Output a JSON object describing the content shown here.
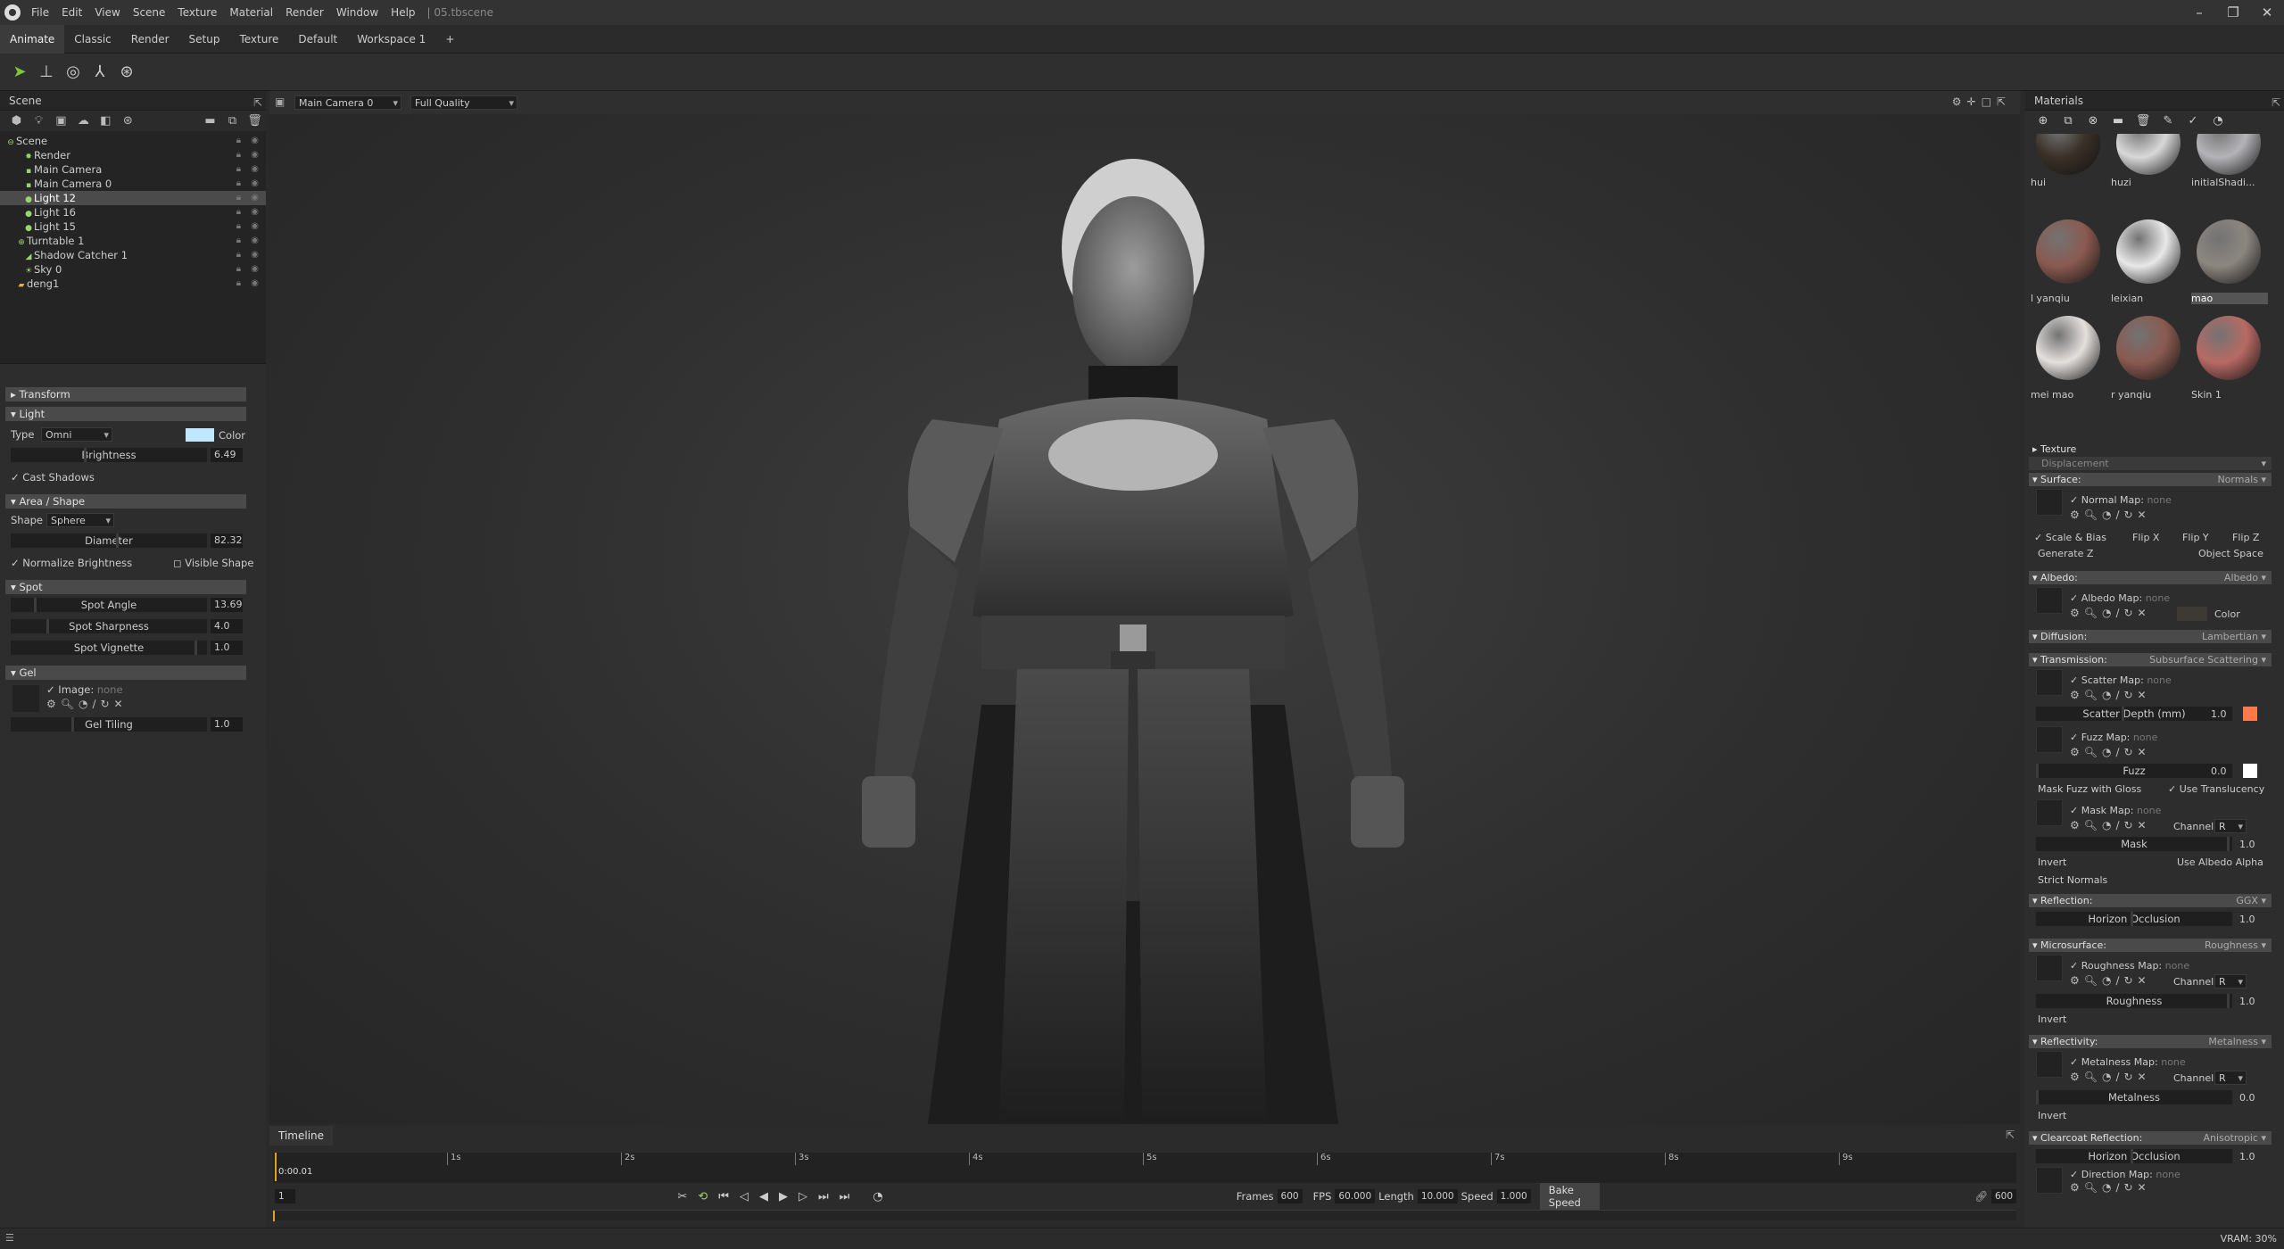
{
  "app": {
    "file_title": "05.tbscene"
  },
  "menu": [
    "File",
    "Edit",
    "View",
    "Scene",
    "Texture",
    "Material",
    "Render",
    "Window",
    "Help"
  ],
  "workspace_tabs": [
    "Animate",
    "Classic",
    "Render",
    "Setup",
    "Texture",
    "Default",
    "Workspace 1",
    "+"
  ],
  "toolbar_icons": [
    "select-arrow-icon",
    "transform-icon",
    "globe-icon",
    "axis-icon",
    "turntable-icon"
  ],
  "scene": {
    "title": "Scene",
    "items": [
      {
        "label": "Scene",
        "icon": "scene-icon"
      },
      {
        "label": "Render",
        "icon": "render-icon"
      },
      {
        "label": "Main Camera",
        "icon": "camera-icon"
      },
      {
        "label": "Main Camera 0",
        "icon": "camera-icon"
      },
      {
        "label": "Light 12",
        "icon": "light-icon",
        "selected": true
      },
      {
        "label": "Light 16",
        "icon": "light-icon"
      },
      {
        "label": "Light 15",
        "icon": "light-icon"
      },
      {
        "label": "Turntable 1",
        "icon": "turntable-icon"
      },
      {
        "label": "Shadow Catcher 1",
        "icon": "shadow-icon"
      },
      {
        "label": "Sky 0",
        "icon": "sky-icon"
      },
      {
        "label": "deng1",
        "icon": "folder-icon"
      }
    ]
  },
  "props": {
    "transform": "Transform",
    "light": "Light",
    "type_label": "Type",
    "type_value": "Omni",
    "color_label": "Color",
    "light_color": "#bfe8ff",
    "brightness_label": "Brightness",
    "brightness_value": "6.49",
    "cast_shadows": "Cast Shadows",
    "area_shape": "Area / Shape",
    "shape_label": "Shape",
    "shape_value": "Sphere",
    "diameter_label": "Diameter",
    "diameter_value": "82.32",
    "normalize": "Normalize Brightness",
    "visible_shape": "Visible Shape",
    "spot": "Spot",
    "spot_angle_label": "Spot Angle",
    "spot_angle_value": "13.69",
    "spot_sharp_label": "Spot Sharpness",
    "spot_sharp_value": "4.0",
    "spot_vig_label": "Spot Vignette",
    "spot_vig_value": "1.0",
    "gel": "Gel",
    "image_label": "Image:",
    "image_value": "none",
    "gel_tiling_label": "Gel Tiling",
    "gel_tiling_value": "1.0"
  },
  "viewport": {
    "camera": "Main Camera 0",
    "quality": "Full Quality"
  },
  "timeline": {
    "tab": "Timeline",
    "current_time": "0:00.01",
    "marks": [
      "1s",
      "2s",
      "3s",
      "4s",
      "5s",
      "6s",
      "7s",
      "8s",
      "9s"
    ],
    "start_frame": "1",
    "end_frame": "600",
    "frames_label": "Frames",
    "frames_value": "600",
    "fps_label": "FPS",
    "fps_value": "60.000",
    "length_label": "Length",
    "length_value": "10.000",
    "speed_label": "Speed",
    "speed_value": "1.000",
    "bake_speed": "Bake Speed"
  },
  "status": {
    "vram": "VRAM: 30%"
  },
  "materials": {
    "title": "Materials",
    "items": [
      {
        "label": "hui",
        "color": "#3a3128"
      },
      {
        "label": "huzi",
        "color": "#d8d8d8"
      },
      {
        "label": "initialShadi...",
        "color": "#b4b4b8"
      },
      {
        "label": "l yanqiu",
        "color": "#8a5a50"
      },
      {
        "label": "leixian",
        "color": "#e8e8e8"
      },
      {
        "label": "mao",
        "color": "#8c8680",
        "selected": true
      },
      {
        "label": "mei mao",
        "color": "#e4e0dc"
      },
      {
        "label": "r yanqiu",
        "color": "#8a5a50"
      },
      {
        "label": "Skin 1",
        "color": "#b86a64"
      }
    ],
    "texture": "Texture",
    "displacement": "Displacement",
    "surface": "Surface:",
    "surface_value": "Normals",
    "normal_map": "Normal Map:",
    "none": "none",
    "scale_bias": "Scale & Bias",
    "flip_x": "Flip X",
    "flip_y": "Flip Y",
    "flip_z": "Flip Z",
    "generate_z": "Generate Z",
    "object_space": "Object Space",
    "albedo": "Albedo:",
    "albedo_value": "Albedo",
    "albedo_map": "Albedo Map:",
    "color": "Color",
    "albedo_color": "#3d3a36",
    "diffusion": "Diffusion:",
    "diffusion_value": "Lambertian",
    "transmission": "Transmission:",
    "transmission_value": "Subsurface Scattering",
    "scatter_map": "Scatter Map:",
    "scatter_depth": "Scatter Depth (mm)",
    "scatter_depth_value": "1.0",
    "scatter_color": "#ff7a4a",
    "fuzz_map": "Fuzz Map:",
    "fuzz": "Fuzz",
    "fuzz_value": "0.0",
    "fuzz_color": "#ffffff",
    "mask_fuzz": "Mask Fuzz with Gloss",
    "use_translucency": "Use Translucency",
    "mask_map": "Mask Map:",
    "channel": "Channel",
    "channel_value": "R",
    "mask": "Mask",
    "mask_value": "1.0",
    "invert": "Invert",
    "use_albedo_alpha": "Use Albedo Alpha",
    "strict_normals": "Strict Normals",
    "reflection": "Reflection:",
    "reflection_value": "GGX",
    "horizon_occlusion": "Horizon Occlusion",
    "horizon_value": "1.0",
    "microsurface": "Microsurface:",
    "microsurface_value": "Roughness",
    "roughness_map": "Roughness Map:",
    "roughness": "Roughness",
    "roughness_value": "1.0",
    "reflectivity": "Reflectivity:",
    "reflectivity_value": "Metalness",
    "metalness_map": "Metalness Map:",
    "metalness": "Metalness",
    "metalness_value": "0.0",
    "clearcoat": "Clearcoat Reflection:",
    "clearcoat_value": "Anisotropic",
    "direction_map": "Direction Map:"
  }
}
